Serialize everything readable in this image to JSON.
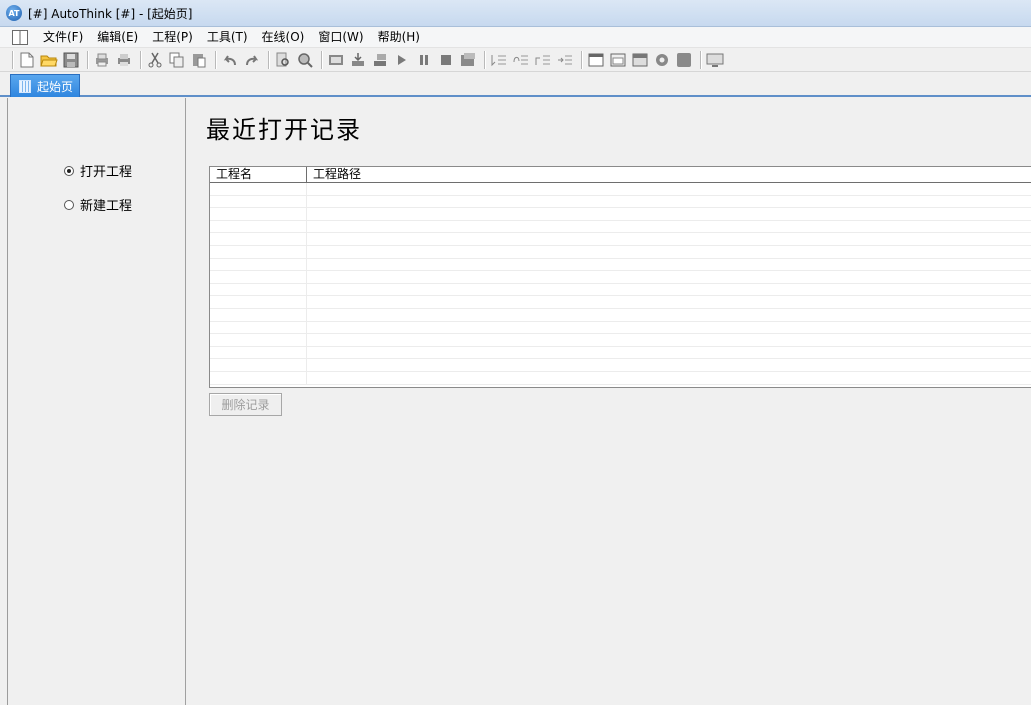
{
  "window": {
    "title": "[#] AutoThink [#] - [起始页]",
    "logo_text": "AT"
  },
  "menu": [
    {
      "label": "文件(F)"
    },
    {
      "label": "编辑(E)"
    },
    {
      "label": "工程(P)"
    },
    {
      "label": "工具(T)"
    },
    {
      "label": "在线(O)"
    },
    {
      "label": "窗口(W)"
    },
    {
      "label": "帮助(H)"
    }
  ],
  "tab": {
    "label": "起始页"
  },
  "left_pane": {
    "open_project": "打开工程",
    "new_project": "新建工程",
    "selected": "open_project"
  },
  "main": {
    "heading": "最近打开记录",
    "table": {
      "columns": [
        "工程名",
        "工程路径"
      ],
      "rows": []
    },
    "delete_button": "删除记录"
  }
}
